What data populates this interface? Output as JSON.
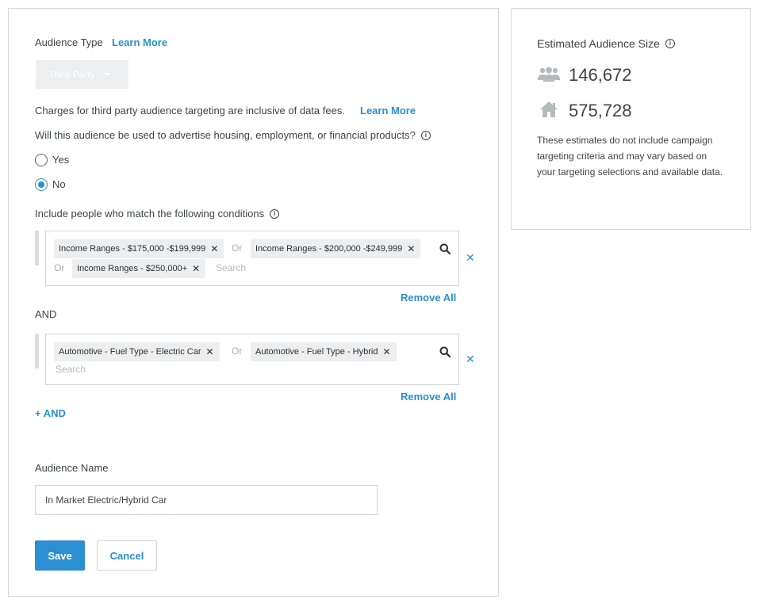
{
  "audience_type": {
    "label": "Audience Type",
    "learn_more": "Learn More",
    "dropdown_value": "Third Party"
  },
  "charges_note": {
    "text": "Charges for third party audience targeting are inclusive of data fees.",
    "learn_more": "Learn More"
  },
  "question": {
    "text": "Will this audience be used to advertise housing, employment, or financial products?",
    "options": [
      {
        "label": "Yes",
        "checked": false
      },
      {
        "label": "No",
        "checked": true
      }
    ]
  },
  "conditions": {
    "heading": "Include people who match the following conditions",
    "or_label": "Or",
    "and_label": "AND",
    "search_placeholder": "Search",
    "remove_all": "Remove All",
    "add_and": "+ AND",
    "groups": [
      {
        "chips": [
          "Income Ranges - $175,000 -$199,999",
          "Income Ranges - $200,000 -$249,999",
          "Income Ranges - $250,000+"
        ]
      },
      {
        "chips": [
          "Automotive - Fuel Type - Electric Car",
          "Automotive - Fuel Type - Hybrid"
        ]
      }
    ]
  },
  "audience_name": {
    "label": "Audience Name",
    "value": "In Market Electric/Hybrid Car"
  },
  "buttons": {
    "save": "Save",
    "cancel": "Cancel"
  },
  "estimate": {
    "title": "Estimated Audience Size",
    "people_count": "146,672",
    "household_count": "575,728",
    "note": "These estimates do not include campaign targeting criteria and may vary based on your targeting selections and available data."
  },
  "colors": {
    "accent": "#2b8fd1",
    "chip_bg": "#eceeef",
    "border": "#d6d9db"
  }
}
